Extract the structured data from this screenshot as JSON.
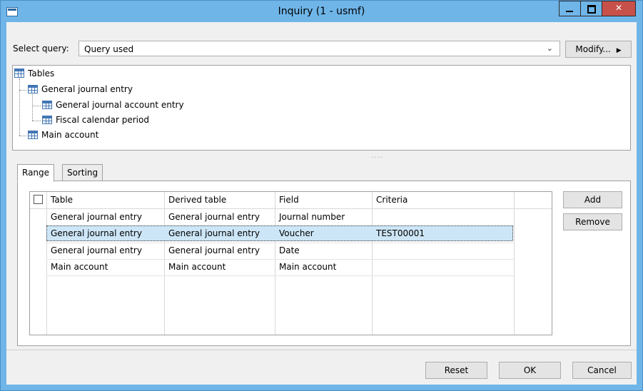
{
  "window": {
    "title": "Inquiry (1 - usmf)"
  },
  "query": {
    "label": "Select query:",
    "selected": "Query used",
    "modify_label": "Modify..."
  },
  "tree": {
    "root": "Tables",
    "nodes": [
      "General journal entry",
      "General journal account entry",
      "Fiscal calendar period",
      "Main account"
    ]
  },
  "tabs": [
    "Range",
    "Sorting"
  ],
  "grid": {
    "columns": [
      "Table",
      "Derived table",
      "Field",
      "Criteria"
    ],
    "rows": [
      [
        "General journal entry",
        "General journal entry",
        "Journal number",
        ""
      ],
      [
        "General journal entry",
        "General journal entry",
        "Voucher",
        "TEST00001"
      ],
      [
        "General journal entry",
        "General journal entry",
        "Date",
        ""
      ],
      [
        "Main account",
        "Main account",
        "Main account",
        ""
      ]
    ]
  },
  "side_buttons": {
    "add": "Add",
    "remove": "Remove"
  },
  "footer": {
    "reset": "Reset",
    "ok": "OK",
    "cancel": "Cancel"
  },
  "colors": {
    "titlebar": "#6fb5e8",
    "selection": "#cde6f7",
    "close": "#c7514a"
  }
}
